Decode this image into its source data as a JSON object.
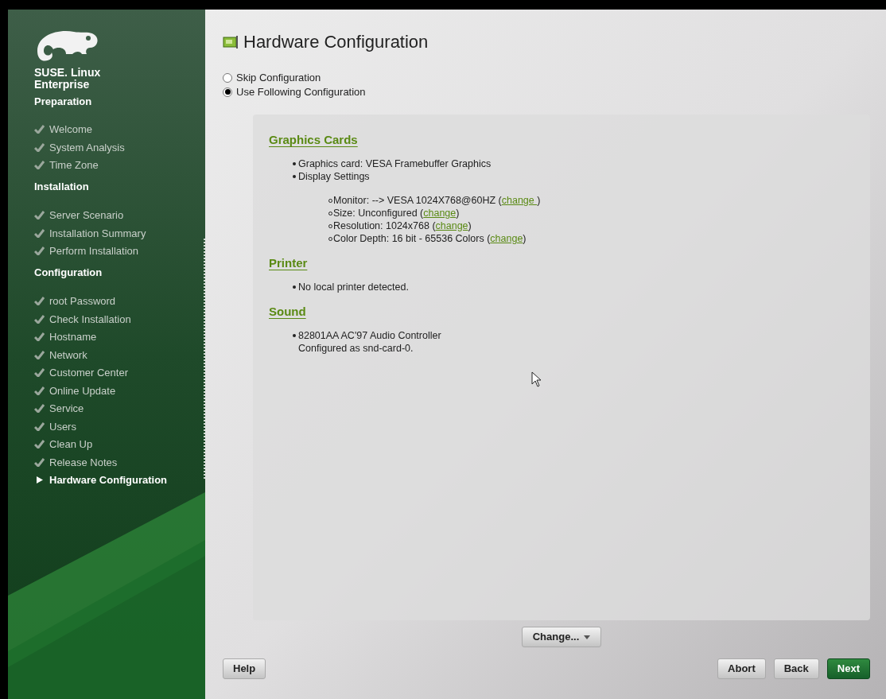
{
  "sidebar": {
    "brand": [
      "SUSE. Linux",
      "Enterprise"
    ],
    "sections": [
      {
        "title": "Preparation",
        "items": [
          {
            "label": "Welcome",
            "current": false
          },
          {
            "label": "System Analysis",
            "current": false
          },
          {
            "label": "Time Zone",
            "current": false
          }
        ]
      },
      {
        "title": "Installation",
        "items": [
          {
            "label": "Server Scenario",
            "current": false
          },
          {
            "label": "Installation Summary",
            "current": false
          },
          {
            "label": "Perform Installation",
            "current": false
          }
        ]
      },
      {
        "title": "Configuration",
        "items": [
          {
            "label": "root Password",
            "current": false
          },
          {
            "label": "Check Installation",
            "current": false
          },
          {
            "label": "Hostname",
            "current": false
          },
          {
            "label": "Network",
            "current": false
          },
          {
            "label": "Customer Center",
            "current": false
          },
          {
            "label": "Online Update",
            "current": false
          },
          {
            "label": "Service",
            "current": false
          },
          {
            "label": "Users",
            "current": false
          },
          {
            "label": "Clean Up",
            "current": false
          },
          {
            "label": "Release Notes",
            "current": false
          },
          {
            "label": "Hardware Configuration",
            "current": true
          }
        ]
      }
    ]
  },
  "title": "Hardware Configuration",
  "options": [
    {
      "label": "Skip Configuration",
      "selected": false
    },
    {
      "label": "Use Following Configuration",
      "selected": true
    }
  ],
  "sections": [
    {
      "heading": "Graphics Cards",
      "bullets": [
        {
          "text": "Graphics card: VESA Framebuffer Graphics"
        },
        {
          "text": "Display Settings",
          "sub": [
            {
              "prefix": "Monitor: --> VESA 1024X768@60HZ (",
              "link": "change ",
              "suffix": ")"
            },
            {
              "prefix": "Size: Unconfigured (",
              "link": "change",
              "suffix": ")"
            },
            {
              "prefix": "Resolution: 1024x768 (",
              "link": "change",
              "suffix": ")"
            },
            {
              "prefix": "Color Depth: 16 bit - 65536 Colors (",
              "link": "change",
              "suffix": ")"
            }
          ]
        }
      ]
    },
    {
      "heading": "Printer",
      "bullets": [
        {
          "text": "No local printer detected."
        }
      ]
    },
    {
      "heading": "Sound",
      "bullets": [
        {
          "text": "82801AA AC'97 Audio Controller",
          "note": "Configured as snd-card-0."
        }
      ]
    }
  ],
  "change_button": {
    "label": "Change..."
  },
  "buttons": [
    {
      "label": "Help",
      "kind": "plain"
    },
    {
      "label": "Abort",
      "kind": "plain"
    },
    {
      "label": "Back",
      "kind": "plain"
    },
    {
      "label": "Next",
      "kind": "primary"
    }
  ]
}
